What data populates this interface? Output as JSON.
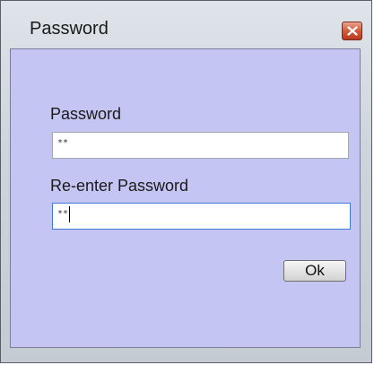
{
  "dialog": {
    "title": "Password",
    "password_label": "Password",
    "password_value": "**",
    "reenter_label": "Re-enter Password",
    "reenter_value": "**",
    "ok_label": "Ok"
  },
  "icons": {
    "close": "close-icon"
  },
  "colors": {
    "client_background": "#c5c5f3",
    "close_button": "#d35a3c",
    "focus_border": "#3d7bd6"
  }
}
